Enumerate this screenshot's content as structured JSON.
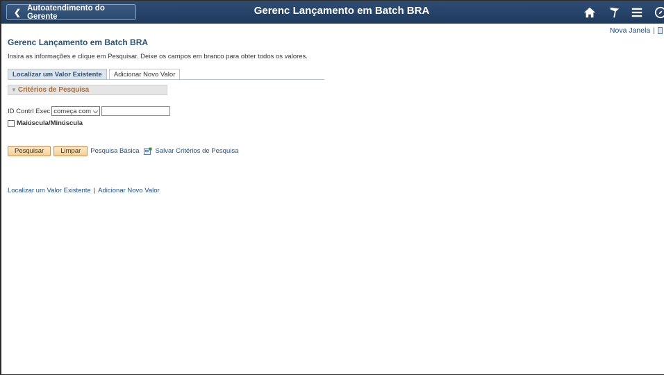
{
  "header": {
    "back_label": "Autoatendimento do Gerente",
    "title": "Gerenc Lançamento em Batch BRA",
    "icons": [
      "home-icon",
      "flag-icon",
      "menu-icon",
      "navbar-icon"
    ]
  },
  "topbar": {
    "new_window": "Nova Janela",
    "separator": "|"
  },
  "page": {
    "title": "Gerenc Lançamento em Batch BRA",
    "instructions": "Insira as informações e clique em Pesquisar. Deixe os campos em branco para obter todos os valores."
  },
  "tabs": [
    {
      "label": "Localizar um Valor Existente",
      "active": true
    },
    {
      "label": "Adicionar Novo Valor",
      "active": false
    }
  ],
  "criteria": {
    "header": "Critérios de Pesquisa",
    "field_label": "ID Contrl Exec",
    "operator": "começa com",
    "value": "",
    "case_label": "Maiúscula/Minúscula"
  },
  "actions": {
    "search": "Pesquisar",
    "clear": "Limpar",
    "basic_search": "Pesquisa Básica",
    "save_criteria": "Salvar Critérios de Pesquisa"
  },
  "footer_links": {
    "find": "Localizar um Valor Existente",
    "separator": "|",
    "add": "Adicionar Novo Valor"
  },
  "colors": {
    "banner": "#1e3a5e",
    "link": "#1a4f8b",
    "button": "#f7cf92"
  }
}
